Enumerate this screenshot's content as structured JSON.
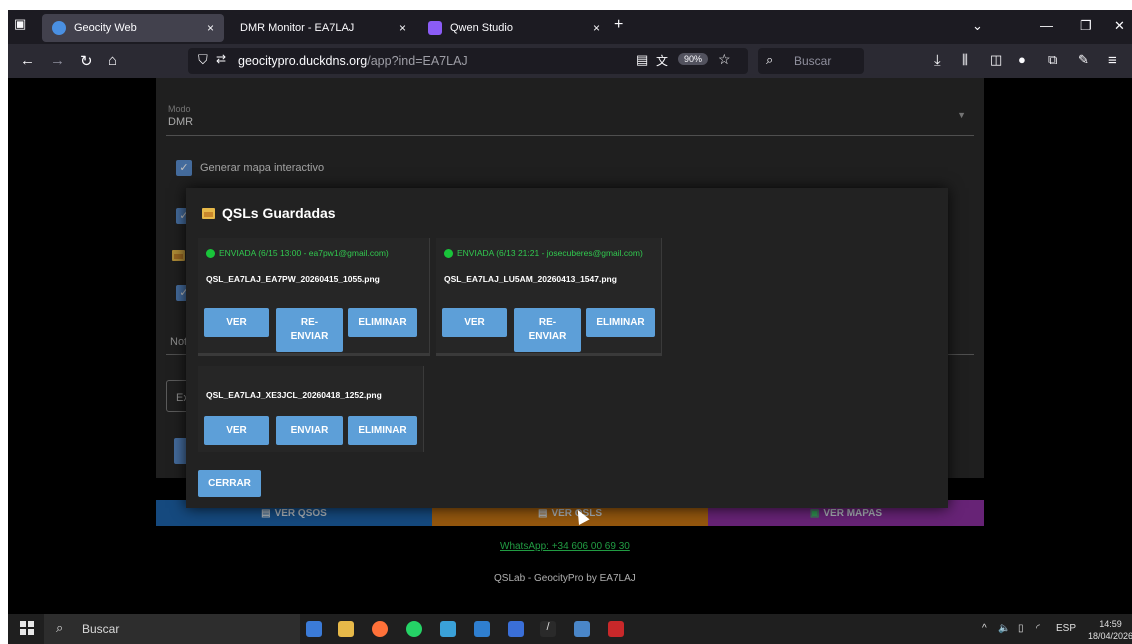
{
  "browser": {
    "tabs": [
      {
        "title": "Geocity Web",
        "close": "×",
        "active": true
      },
      {
        "title": "DMR Monitor - EA7LAJ",
        "close": "×",
        "active": false
      },
      {
        "title": "Qwen Studio",
        "close": "×",
        "active": false
      }
    ],
    "new_tab": "+",
    "url_domain": "geocitypro.duckdns.org",
    "url_path": "/app?ind=EA7LAJ",
    "zoom": "90%",
    "search_placeholder": "Buscar"
  },
  "form": {
    "mode_label": "Modo",
    "mode_value": "DMR",
    "checkbox_interactive_map": "Generar mapa interactivo",
    "notes_fragment": "Not",
    "input_fragment": "Ex"
  },
  "modal": {
    "title": "QSLs Guardadas",
    "cards": [
      {
        "status": "ENVIADA (6/15 13:00 - ea7pw1@gmail.com)",
        "filename": "QSL_EA7LAJ_EA7PW_20260415_1055.png",
        "buttons": [
          "VER",
          "RE-ENVIAR",
          "ELIMINAR"
        ]
      },
      {
        "status": "ENVIADA (6/13 21:21 - josecuberes@gmail.com)",
        "filename": "QSL_EA7LAJ_LU5AM_20260413_1547.png",
        "buttons": [
          "VER",
          "RE-ENVIAR",
          "ELIMINAR"
        ]
      },
      {
        "status": "",
        "filename": "QSL_EA7LAJ_XE3JCL_20260418_1252.png",
        "buttons": [
          "VER",
          "ENVIAR",
          "ELIMINAR"
        ]
      }
    ],
    "close_label": "CERRAR"
  },
  "bottom_buttons": [
    {
      "label": "VER QSOS",
      "color": "#1c62a8"
    },
    {
      "label": "VER QSLS",
      "color": "#c67513"
    },
    {
      "label": "VER MAPAS",
      "color": "#8a2f9e"
    }
  ],
  "whatsapp": "WhatsApp: +34 606 00 69 30",
  "footer": "QSLab - GeocityPro by EA7LAJ",
  "taskbar": {
    "search_placeholder": "Buscar",
    "lang": "ESP",
    "time": "14:59",
    "date": "18/04/2026"
  },
  "colors": {
    "accent_button": "#5d9fd8",
    "status_green": "#31c94f",
    "folder": "#e7b949"
  }
}
